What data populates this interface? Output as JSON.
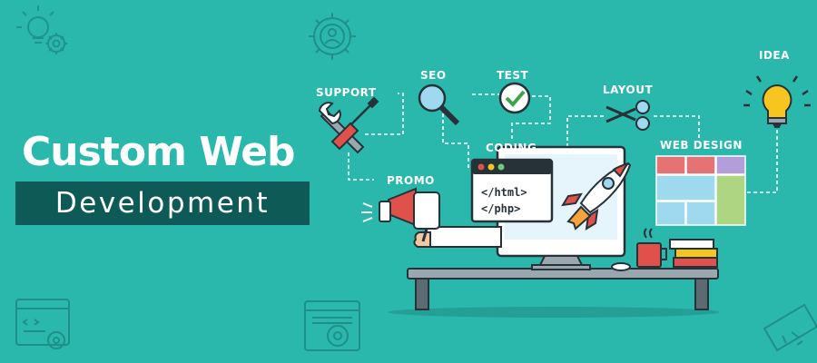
{
  "banner": {
    "title_line1": "Custom Web",
    "title_line2": "Development"
  },
  "labels": {
    "support": "SUPPORT",
    "seo": "SEO",
    "test": "TEST",
    "layout": "LAYOUT",
    "idea": "IDEA",
    "coding": "CODING",
    "web_design": "WEB DESIGN",
    "promo": "PROMO"
  },
  "code_window": {
    "line1": "</html>",
    "line2": "</php>"
  },
  "colors": {
    "background": "#2ab8ad",
    "title_box": "#0e5a56",
    "dark_outline": "#263238",
    "accent_red": "#e0514b",
    "accent_yellow": "#f7c520"
  }
}
